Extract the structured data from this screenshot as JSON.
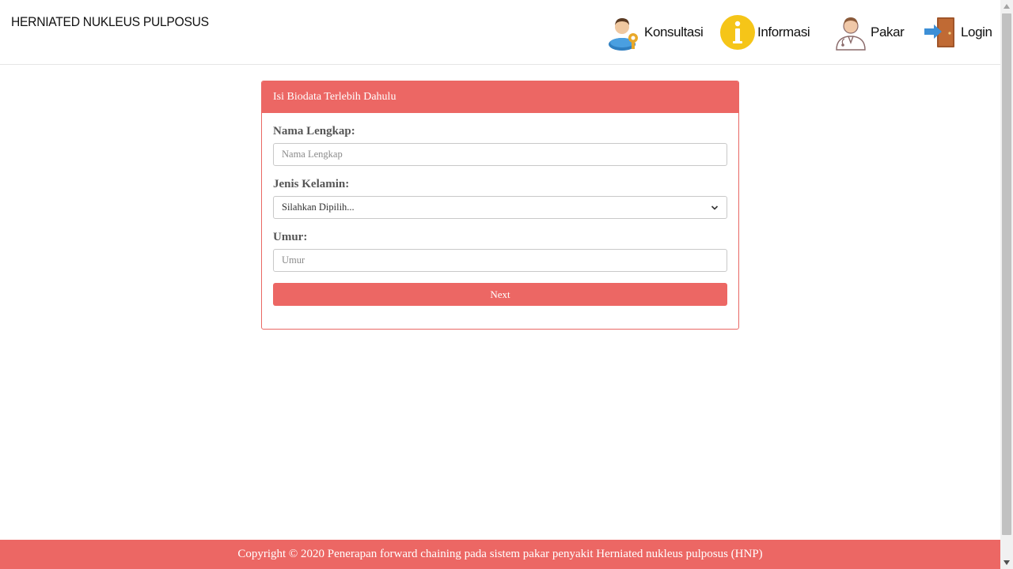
{
  "header": {
    "brand": "HERNIATED NUKLEUS PULPOSUS",
    "nav": {
      "konsultasi": "Konsultasi",
      "informasi": "Informasi",
      "pakar": "Pakar",
      "login": "Login"
    },
    "icons": {
      "konsultasi": "user-key-icon",
      "informasi": "info-icon",
      "pakar": "doctor-icon",
      "login": "door-enter-icon"
    }
  },
  "form": {
    "title": "Isi Biodata Terlebih Dahulu",
    "name_label": "Nama Lengkap:",
    "name_placeholder": "Nama Lengkap",
    "gender_label": "Jenis Kelamin:",
    "gender_selected": "Silahkan Dipilih...",
    "age_label": "Umur:",
    "age_placeholder": "Umur",
    "next_label": "Next"
  },
  "footer": {
    "copyright": "Copyright © 2020 Penerapan forward chaining pada sistem pakar penyakit Herniated nukleus pulposus (HNP)"
  },
  "colors": {
    "accent": "#ec6764",
    "info": "#f5c518"
  }
}
